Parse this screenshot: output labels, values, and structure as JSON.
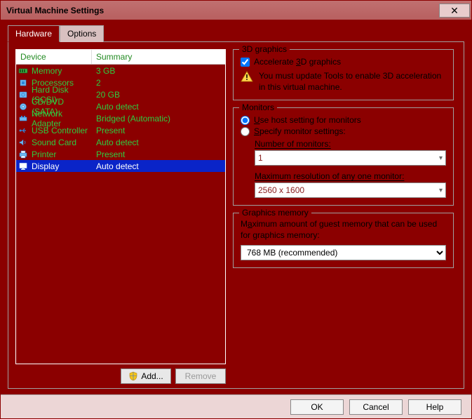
{
  "title": "Virtual Machine Settings",
  "tabs": {
    "hardware": "Hardware",
    "options": "Options"
  },
  "columns": {
    "device": "Device",
    "summary": "Summary"
  },
  "devices": [
    {
      "name": "Memory",
      "summary": "3 GB",
      "icon": "memory"
    },
    {
      "name": "Processors",
      "summary": "2",
      "icon": "cpu"
    },
    {
      "name": "Hard Disk (SCSI)",
      "summary": "20 GB",
      "icon": "hdd"
    },
    {
      "name": "CD/DVD (SATA)",
      "summary": "Auto detect",
      "icon": "cd"
    },
    {
      "name": "Network Adapter",
      "summary": "Bridged (Automatic)",
      "icon": "net"
    },
    {
      "name": "USB Controller",
      "summary": "Present",
      "icon": "usb"
    },
    {
      "name": "Sound Card",
      "summary": "Auto detect",
      "icon": "sound"
    },
    {
      "name": "Printer",
      "summary": "Present",
      "icon": "printer"
    },
    {
      "name": "Display",
      "summary": "Auto detect",
      "icon": "display"
    }
  ],
  "buttons": {
    "add": "Add...",
    "remove": "Remove",
    "ok": "OK",
    "cancel": "Cancel",
    "help": "Help"
  },
  "gfx": {
    "legend": "3D graphics",
    "accel": "Accelerate 3D graphics",
    "warn": "You must update Tools to enable 3D acceleration in this virtual machine."
  },
  "monitors": {
    "legend": "Monitors",
    "useHost": "Use host setting for monitors",
    "specify": "Specify monitor settings:",
    "numLabel": "Number of monitors:",
    "numValue": "1",
    "maxResLabel": "Maximum resolution of any one monitor:",
    "maxResValue": "2560 x 1600"
  },
  "gmem": {
    "legend": "Graphics memory",
    "label": "Maximum amount of guest memory that can be used for graphics memory:",
    "value": "768 MB (recommended)"
  }
}
